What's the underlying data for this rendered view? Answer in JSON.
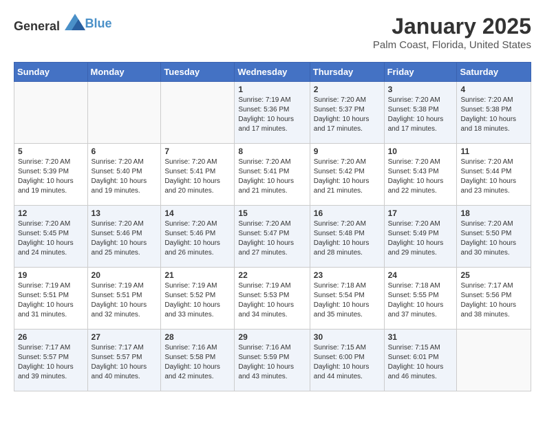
{
  "header": {
    "logo_general": "General",
    "logo_blue": "Blue",
    "title": "January 2025",
    "subtitle": "Palm Coast, Florida, United States"
  },
  "weekdays": [
    "Sunday",
    "Monday",
    "Tuesday",
    "Wednesday",
    "Thursday",
    "Friday",
    "Saturday"
  ],
  "weeks": [
    [
      {
        "day": "",
        "info": ""
      },
      {
        "day": "",
        "info": ""
      },
      {
        "day": "",
        "info": ""
      },
      {
        "day": "1",
        "info": "Sunrise: 7:19 AM\nSunset: 5:36 PM\nDaylight: 10 hours\nand 17 minutes."
      },
      {
        "day": "2",
        "info": "Sunrise: 7:20 AM\nSunset: 5:37 PM\nDaylight: 10 hours\nand 17 minutes."
      },
      {
        "day": "3",
        "info": "Sunrise: 7:20 AM\nSunset: 5:38 PM\nDaylight: 10 hours\nand 17 minutes."
      },
      {
        "day": "4",
        "info": "Sunrise: 7:20 AM\nSunset: 5:38 PM\nDaylight: 10 hours\nand 18 minutes."
      }
    ],
    [
      {
        "day": "5",
        "info": "Sunrise: 7:20 AM\nSunset: 5:39 PM\nDaylight: 10 hours\nand 19 minutes."
      },
      {
        "day": "6",
        "info": "Sunrise: 7:20 AM\nSunset: 5:40 PM\nDaylight: 10 hours\nand 19 minutes."
      },
      {
        "day": "7",
        "info": "Sunrise: 7:20 AM\nSunset: 5:41 PM\nDaylight: 10 hours\nand 20 minutes."
      },
      {
        "day": "8",
        "info": "Sunrise: 7:20 AM\nSunset: 5:41 PM\nDaylight: 10 hours\nand 21 minutes."
      },
      {
        "day": "9",
        "info": "Sunrise: 7:20 AM\nSunset: 5:42 PM\nDaylight: 10 hours\nand 21 minutes."
      },
      {
        "day": "10",
        "info": "Sunrise: 7:20 AM\nSunset: 5:43 PM\nDaylight: 10 hours\nand 22 minutes."
      },
      {
        "day": "11",
        "info": "Sunrise: 7:20 AM\nSunset: 5:44 PM\nDaylight: 10 hours\nand 23 minutes."
      }
    ],
    [
      {
        "day": "12",
        "info": "Sunrise: 7:20 AM\nSunset: 5:45 PM\nDaylight: 10 hours\nand 24 minutes."
      },
      {
        "day": "13",
        "info": "Sunrise: 7:20 AM\nSunset: 5:46 PM\nDaylight: 10 hours\nand 25 minutes."
      },
      {
        "day": "14",
        "info": "Sunrise: 7:20 AM\nSunset: 5:46 PM\nDaylight: 10 hours\nand 26 minutes."
      },
      {
        "day": "15",
        "info": "Sunrise: 7:20 AM\nSunset: 5:47 PM\nDaylight: 10 hours\nand 27 minutes."
      },
      {
        "day": "16",
        "info": "Sunrise: 7:20 AM\nSunset: 5:48 PM\nDaylight: 10 hours\nand 28 minutes."
      },
      {
        "day": "17",
        "info": "Sunrise: 7:20 AM\nSunset: 5:49 PM\nDaylight: 10 hours\nand 29 minutes."
      },
      {
        "day": "18",
        "info": "Sunrise: 7:20 AM\nSunset: 5:50 PM\nDaylight: 10 hours\nand 30 minutes."
      }
    ],
    [
      {
        "day": "19",
        "info": "Sunrise: 7:19 AM\nSunset: 5:51 PM\nDaylight: 10 hours\nand 31 minutes."
      },
      {
        "day": "20",
        "info": "Sunrise: 7:19 AM\nSunset: 5:51 PM\nDaylight: 10 hours\nand 32 minutes."
      },
      {
        "day": "21",
        "info": "Sunrise: 7:19 AM\nSunset: 5:52 PM\nDaylight: 10 hours\nand 33 minutes."
      },
      {
        "day": "22",
        "info": "Sunrise: 7:19 AM\nSunset: 5:53 PM\nDaylight: 10 hours\nand 34 minutes."
      },
      {
        "day": "23",
        "info": "Sunrise: 7:18 AM\nSunset: 5:54 PM\nDaylight: 10 hours\nand 35 minutes."
      },
      {
        "day": "24",
        "info": "Sunrise: 7:18 AM\nSunset: 5:55 PM\nDaylight: 10 hours\nand 37 minutes."
      },
      {
        "day": "25",
        "info": "Sunrise: 7:17 AM\nSunset: 5:56 PM\nDaylight: 10 hours\nand 38 minutes."
      }
    ],
    [
      {
        "day": "26",
        "info": "Sunrise: 7:17 AM\nSunset: 5:57 PM\nDaylight: 10 hours\nand 39 minutes."
      },
      {
        "day": "27",
        "info": "Sunrise: 7:17 AM\nSunset: 5:57 PM\nDaylight: 10 hours\nand 40 minutes."
      },
      {
        "day": "28",
        "info": "Sunrise: 7:16 AM\nSunset: 5:58 PM\nDaylight: 10 hours\nand 42 minutes."
      },
      {
        "day": "29",
        "info": "Sunrise: 7:16 AM\nSunset: 5:59 PM\nDaylight: 10 hours\nand 43 minutes."
      },
      {
        "day": "30",
        "info": "Sunrise: 7:15 AM\nSunset: 6:00 PM\nDaylight: 10 hours\nand 44 minutes."
      },
      {
        "day": "31",
        "info": "Sunrise: 7:15 AM\nSunset: 6:01 PM\nDaylight: 10 hours\nand 46 minutes."
      },
      {
        "day": "",
        "info": ""
      }
    ]
  ]
}
